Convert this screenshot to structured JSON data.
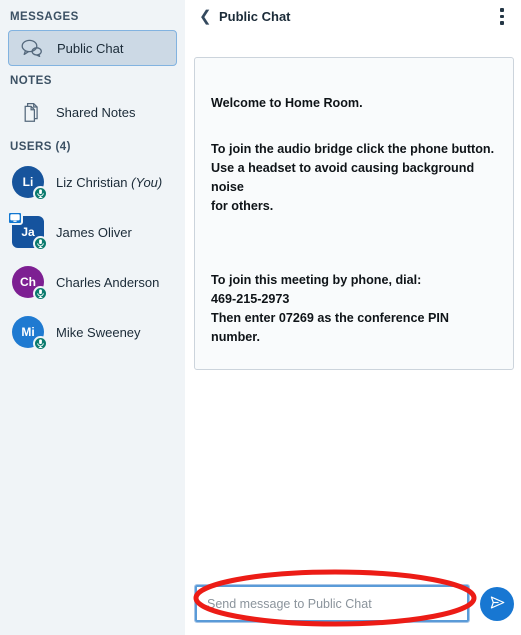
{
  "sidebar": {
    "messages_section": "MESSAGES",
    "notes_section": "NOTES",
    "users_section": "USERS (4)",
    "items": [
      {
        "label": "Public Chat",
        "icon": "chat-bubbles-icon",
        "selected": true
      },
      {
        "label": "Shared Notes",
        "icon": "pages-icon",
        "selected": false
      }
    ],
    "users": [
      {
        "initials": "Li",
        "name": "Liz Christian",
        "suffix": "(You)",
        "color": "#17549c",
        "shape": "circle",
        "mic": true,
        "presenter": false
      },
      {
        "initials": "Ja",
        "name": "James Oliver",
        "suffix": "",
        "color": "#15539e",
        "shape": "square",
        "mic": true,
        "presenter": true
      },
      {
        "initials": "Ch",
        "name": "Charles Anderson",
        "suffix": "",
        "color": "#7d1f92",
        "shape": "circle",
        "mic": true,
        "presenter": false
      },
      {
        "initials": "Mi",
        "name": "Mike Sweeney",
        "suffix": "",
        "color": "#1f7ad1",
        "shape": "circle",
        "mic": true,
        "presenter": false
      }
    ]
  },
  "chat": {
    "title": "Public Chat",
    "back_icon": "chevron-left-icon",
    "options_icon": "kebab-menu-icon",
    "welcome": {
      "line1_prefix": "Welcome to ",
      "line1_room": "Home Room",
      "line1_suffix": ".",
      "line2": "To join the audio bridge click the phone button.",
      "line3": "Use a headset to avoid causing background noise",
      "line4": "for others.",
      "line5": "To join this meeting by phone, dial:",
      "phone": "469-215-2973",
      "line7": "Then enter 07269 as the conference PIN number."
    },
    "input_placeholder": "Send message to Public Chat",
    "input_value": "",
    "send_label": "Send",
    "send_icon": "paper-plane-icon"
  },
  "annotation": {
    "shape": "ellipse",
    "color": "#ec1c16",
    "stroke_width": 5,
    "target": "message-input"
  },
  "colors": {
    "sidebar_bg": "#f0f4f7",
    "main_bg": "#ffffff",
    "selected_item_bg": "#ccd9e5",
    "selected_item_border": "#82b3e0",
    "accent_blue": "#1877d2",
    "mic_green": "#0b7b6e",
    "text_dark": "#1b2b38",
    "annotation_red": "#ec1c16"
  }
}
